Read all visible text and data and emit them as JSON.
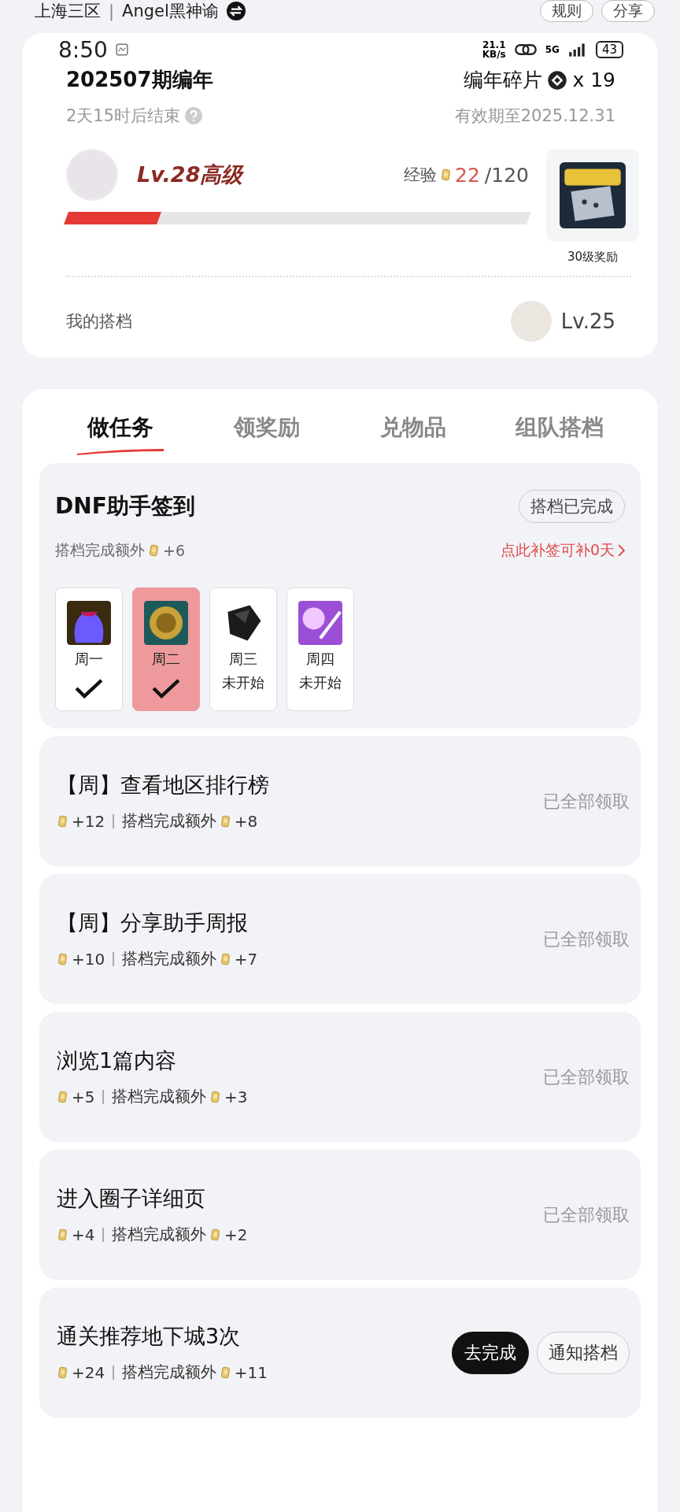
{
  "top_bar": {
    "server": "上海三区",
    "separator": "|",
    "character": "Angel黑神谕",
    "buttons": [
      "规则",
      "分享"
    ]
  },
  "status_bar": {
    "time": "8:50",
    "speed": "21.1",
    "speed_unit": "KB/s",
    "network": "5G",
    "battery": "43"
  },
  "season": {
    "title": "202507期编年",
    "countdown": "2天15时后结束",
    "fragments_label": "编年碎片",
    "fragments_count": "x 19",
    "valid_until": "有效期至2025.12.31"
  },
  "level": {
    "name": "Lv.28高级",
    "exp_label": "经验",
    "exp_current": "22",
    "exp_total": "/120",
    "level": 0.2,
    "reward_label": "30级奖励"
  },
  "partner": {
    "label": "我的搭档",
    "level_text": "Lv.25"
  },
  "tabs": [
    {
      "label": "做任务",
      "selected": true
    },
    {
      "label": "领奖励",
      "selected": false
    },
    {
      "label": "兑物品",
      "selected": false
    },
    {
      "label": "组队搭档",
      "selected": false
    }
  ],
  "checkin": {
    "title": "DNF助手签到",
    "badge": "搭档已完成",
    "extra_label": "搭档完成额外",
    "extra_value": "+6",
    "makeup_link": "点此补签可补0天",
    "days": [
      {
        "label": "周一",
        "checked": true,
        "selected": false,
        "kind": "bag"
      },
      {
        "label": "周二",
        "checked": true,
        "selected": true,
        "kind": "coin"
      },
      {
        "label": "周三",
        "status": "未开始",
        "checked": false,
        "selected": false,
        "kind": "gem"
      },
      {
        "label": "周四",
        "status": "未开始",
        "checked": false,
        "selected": false,
        "kind": "crystal"
      }
    ]
  },
  "tasks": [
    {
      "title": "【周】查看地区排行榜",
      "reward": "+12",
      "extra_label": "搭档完成额外",
      "extra": "+8",
      "kind": "done",
      "status": "已全部领取"
    },
    {
      "title": "【周】分享助手周报",
      "reward": "+10",
      "extra_label": "搭档完成额外",
      "extra": "+7",
      "kind": "done",
      "status": "已全部领取"
    },
    {
      "title": "浏览1篇内容",
      "reward": "+5",
      "extra_label": "搭档完成额外",
      "extra": "+3",
      "kind": "done",
      "status": "已全部领取"
    },
    {
      "title": "进入圈子详细页",
      "reward": "+4",
      "extra_label": "搭档完成额外",
      "extra": "+2",
      "kind": "done",
      "status": "已全部领取"
    },
    {
      "title": "通关推荐地下城3次",
      "reward": "+24",
      "extra_label": "搭档完成额外",
      "extra": "+11",
      "kind": "todo",
      "buttons": [
        "去完成",
        "通知搭档"
      ]
    }
  ]
}
